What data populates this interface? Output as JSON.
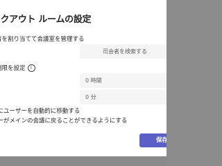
{
  "dialog": {
    "title": "イクアウト ルームの設定",
    "assign_label": "者を割り当てて会議室を管理する",
    "assign_placeholder": "司会者を検索する",
    "time_limit_label": "制限を設定",
    "info_icon": "info-icon",
    "hours_value": "0 時間",
    "minutes_value": "0 分",
    "auto_move_label": "室にユーザーを自動的に移動する",
    "return_label": "ザーがメインの会議に戻ることができるようにする",
    "save_label": "保存"
  }
}
